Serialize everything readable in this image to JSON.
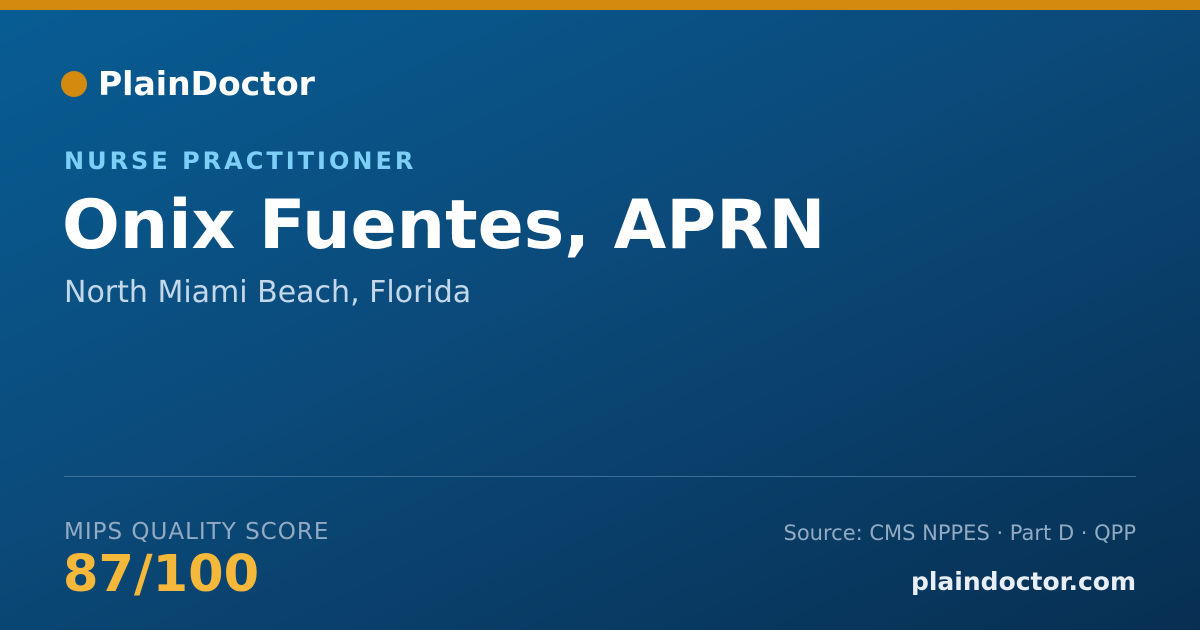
{
  "brand": {
    "name": "PlainDoctor",
    "dot_color": "#d4890f"
  },
  "accent_bar_color": "#d4890f",
  "provider": {
    "specialty": "NURSE PRACTITIONER",
    "name": "Onix Fuentes, APRN",
    "location": "North Miami Beach, Florida"
  },
  "score": {
    "label": "MIPS QUALITY SCORE",
    "value": "87/100",
    "color": "#f5b83a"
  },
  "footer": {
    "source": "Source: CMS NPPES · Part D · QPP",
    "domain": "plaindoctor.com"
  }
}
